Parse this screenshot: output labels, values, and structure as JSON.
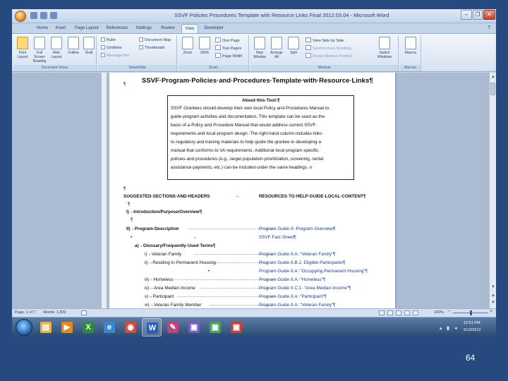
{
  "window": {
    "title": "SSVF Policies Procedures Template with Resource Links Final 2012.03.04 - Microsoft Word",
    "minimize": "–",
    "restore": "❐",
    "close": "✕"
  },
  "ribbon_tabs": [
    "Home",
    "Insert",
    "Page Layout",
    "References",
    "Mailings",
    "Review",
    "View",
    "Developer"
  ],
  "active_tab": "View",
  "ribbon": {
    "document_views": {
      "label": "Document Views",
      "buttons": [
        "Print Layout",
        "Full Screen Reading",
        "Web Layout",
        "Outline",
        "Draft"
      ]
    },
    "show_hide": {
      "label": "Show/Hide",
      "items": [
        "Ruler",
        "Gridlines",
        "Message Bar",
        "Document Map",
        "Thumbnails"
      ]
    },
    "zoom": {
      "label": "Zoom",
      "buttons": [
        "Zoom",
        "100%"
      ],
      "items": [
        "One Page",
        "Two Pages",
        "Page Width"
      ]
    },
    "window": {
      "label": "Window",
      "buttons": [
        "New Window",
        "Arrange All",
        "Split"
      ],
      "items": [
        "View Side by Side",
        "Synchronous Scrolling",
        "Reset Window Position"
      ],
      "switch": "Switch Windows"
    },
    "macros": {
      "label": "Macros",
      "button": "Macros"
    }
  },
  "document": {
    "heading": "SSVF·Program·Policies·and·Procedures·Template·with·Resource·Links¶",
    "about_title": "About·this·Tool:¶",
    "about_lines": [
      "SSVF·Grantees·should·develop·their·own·local·Policy·and·Procedures·Manual·to·",
      "guide·program·activities·and·documentation.·This·template·can·be·used·as·the·",
      "basis·of·a·Policy·and·Procedure·Manual·that·would·address·current·SSVF·",
      "requirements·and·local·program·design.·The·right-hand·column·includes·links·",
      "to·regulatory·and·training·materials·to·help·guide·the·grantee·in·developing·a·",
      "manual·that·conforms·to·VA·requirements.·Additional·local·program·specific·",
      "policies·and·procedures·(e.g.,·target·population·prioritization,·screening,·rental·",
      "assistance·payments,·etc.)·can·be·included·under·the·same·headings.·¤"
    ],
    "col_left_header": "SUGGESTED·SECTIONS·AND·HEADERS",
    "col_right_header": "RESOURCES·TO·HELP·GUIDE·LOCAL·CONTENT¶",
    "sections": [
      {
        "left": "I)→Introduction/Purpose/Overview¶",
        "right": ""
      },
      {
        "left": "II)→Program·Description",
        "right": "Program·Guide·II:·Program·Overview¶"
      },
      {
        "left": "",
        "right": "SSVF·Fact·Sheet¶"
      },
      {
        "left": "a)→Glossary/Frequently·Used·Terms¶",
        "right": ""
      },
      {
        "left": "i)→Veteran·Family",
        "right": "Program·Guide·II.A:·“Veteran·Family”¶"
      },
      {
        "left": "ii)→Residing·in·Permanent·Housing",
        "right": "Program·Guide·II.B.1:·Eligible·Participants¶"
      },
      {
        "left": "",
        "right": "Program·Guide·II.A:·“Occupying·Permanent·Housing”¶"
      },
      {
        "left": "iii)→Homeless",
        "right": "Program·Guide·II.A:·“Homeless”¶"
      },
      {
        "left": "iv)→Area·Median·Income",
        "right": "Program·Guide·II.C.1:·“Area·Median·Income”¶"
      },
      {
        "left": "v)→Participant",
        "right": "Program·Guide·II.A:·“Participant”¶"
      },
      {
        "left": "vi)→Veteran·Family·Member",
        "right": "Program·Guide·II.A:·“Veteran·Family”¶"
      }
    ]
  },
  "statusbar": {
    "page": "Page: 1 of 7",
    "words": "Words: 1,820",
    "zoom": "100%"
  },
  "taskbar": {
    "apps": [
      {
        "name": "explorer",
        "color": "#e6b24a",
        "glyph": "▤"
      },
      {
        "name": "media-player",
        "color": "#e28a1c",
        "glyph": "▶"
      },
      {
        "name": "excel",
        "color": "#2f8a3e",
        "glyph": "X"
      },
      {
        "name": "internet-explorer",
        "color": "#3a86d6",
        "glyph": "e"
      },
      {
        "name": "chrome",
        "color": "#d44b3a",
        "glyph": "◉"
      },
      {
        "name": "word",
        "color": "#2b5fb5",
        "glyph": "W"
      },
      {
        "name": "paint",
        "color": "#c0437d",
        "glyph": "✎"
      },
      {
        "name": "app-purple",
        "color": "#7b5bbf",
        "glyph": "▣"
      },
      {
        "name": "app-green",
        "color": "#4aa35a",
        "glyph": "▣"
      },
      {
        "name": "app-red",
        "color": "#c5423b",
        "glyph": "▣"
      }
    ],
    "time": "12:51 PM",
    "date": "9/13/2012"
  },
  "slide_number": "64",
  "colors": {
    "slide_background": "#26497f",
    "ribbon": "#d6e2f1",
    "document_area": "#aabbd2"
  }
}
